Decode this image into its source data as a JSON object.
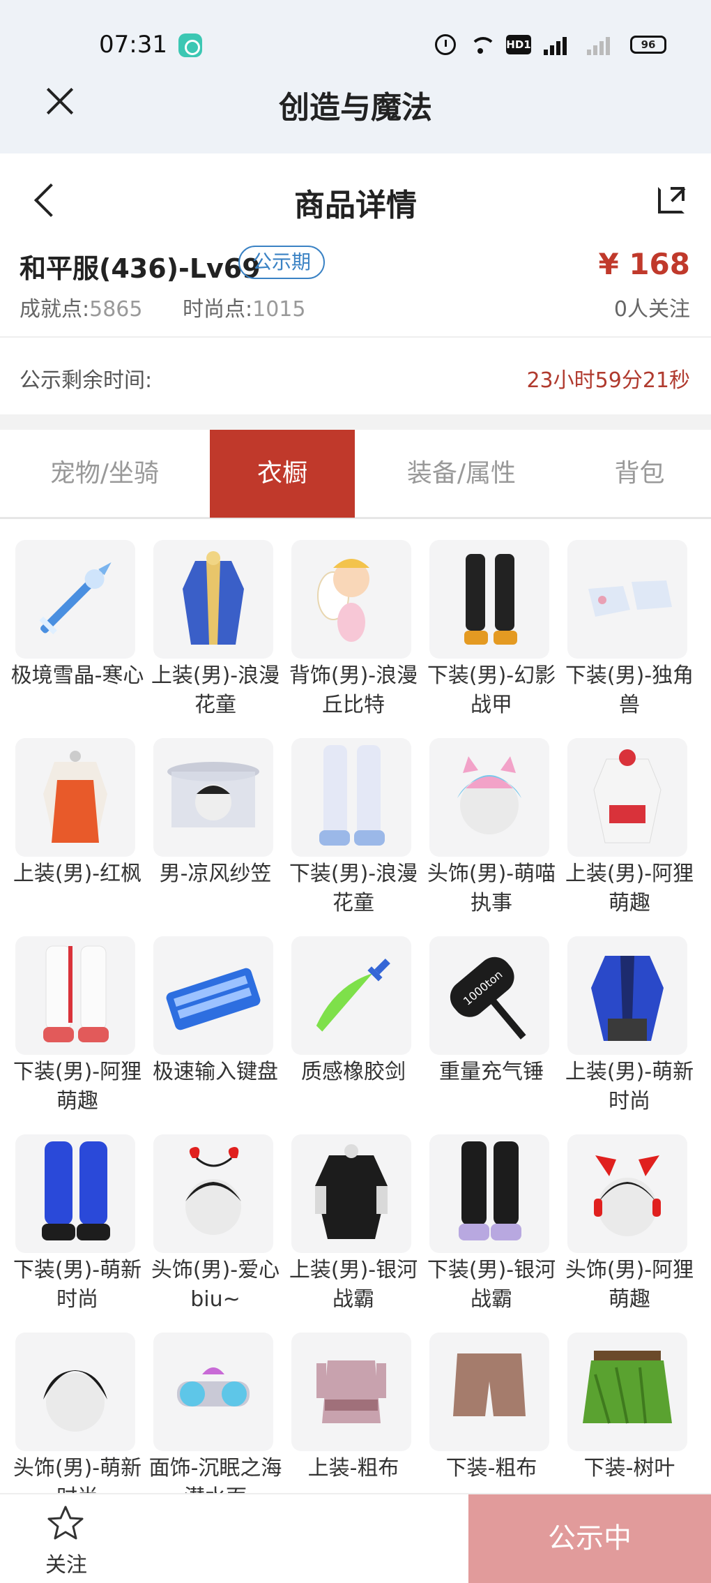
{
  "status_bar": {
    "time": "07:31",
    "hd_label": "HD1",
    "network": "4G",
    "battery": "96"
  },
  "app_header": {
    "title": "创造与魔法"
  },
  "page_header": {
    "title": "商品详情"
  },
  "product": {
    "name": "和平服(436)-Lv69",
    "badge": "公示期",
    "price": "¥ 168",
    "achievement_label": "成就点:",
    "achievement_value": "5865",
    "fashion_label": "时尚点:",
    "fashion_value": "1015",
    "followers": "0人关注"
  },
  "countdown": {
    "label": "公示剩余时间:",
    "value": "23小时59分21秒"
  },
  "tabs": [
    {
      "label": "宠物/坐骑"
    },
    {
      "label": "衣橱"
    },
    {
      "label": "装备/属性"
    },
    {
      "label": "背包"
    }
  ],
  "active_tab": 1,
  "items": [
    {
      "name": "极境雪晶-寒心",
      "icon": "ice-sword"
    },
    {
      "name": "上装(男)-浪漫花童",
      "icon": "blue-gold-robe"
    },
    {
      "name": "背饰(男)-浪漫丘比特",
      "icon": "cupid"
    },
    {
      "name": "下装(男)-幻影战甲",
      "icon": "armor-legs"
    },
    {
      "name": "下装(男)-独角兽",
      "icon": "unicorn-boots"
    },
    {
      "name": "上装(男)-红枫",
      "icon": "red-maple-top"
    },
    {
      "name": "男-凉风纱笠",
      "icon": "veil-hat"
    },
    {
      "name": "下装(男)-浪漫花童",
      "icon": "white-pants"
    },
    {
      "name": "头饰(男)-萌喵执事",
      "icon": "cat-hair"
    },
    {
      "name": "上装(男)-阿狸萌趣",
      "icon": "fox-hoodie"
    },
    {
      "name": "下装(男)-阿狸萌趣",
      "icon": "white-red-pants"
    },
    {
      "name": "极速输入键盘",
      "icon": "keyboard"
    },
    {
      "name": "质感橡胶剑",
      "icon": "rubber-sword"
    },
    {
      "name": "重量充气锤",
      "icon": "hammer"
    },
    {
      "name": "上装(男)-萌新时尚",
      "icon": "blue-jacket"
    },
    {
      "name": "下装(男)-萌新时尚",
      "icon": "blue-pants"
    },
    {
      "name": "头饰(男)-爱心biu~",
      "icon": "heart-headband"
    },
    {
      "name": "上装(男)-银河战霸",
      "icon": "black-top"
    },
    {
      "name": "下装(男)-银河战霸",
      "icon": "black-pants"
    },
    {
      "name": "头饰(男)-阿狸萌趣",
      "icon": "fox-ear-head"
    },
    {
      "name": "头饰(男)-萌新时尚",
      "icon": "black-hair"
    },
    {
      "name": "面饰-沉眠之海潜水面",
      "icon": "diving-mask"
    },
    {
      "name": "上装-粗布",
      "icon": "cloth-top"
    },
    {
      "name": "下装-粗布",
      "icon": "cloth-shorts"
    },
    {
      "name": "下装-树叶",
      "icon": "leaf-skirt"
    }
  ],
  "bottom_bar": {
    "follow_label": "关注",
    "status_label": "公示中"
  },
  "colors": {
    "accent": "#c0392b",
    "badge": "#3a82c4",
    "status_button": "#e19b9b"
  }
}
